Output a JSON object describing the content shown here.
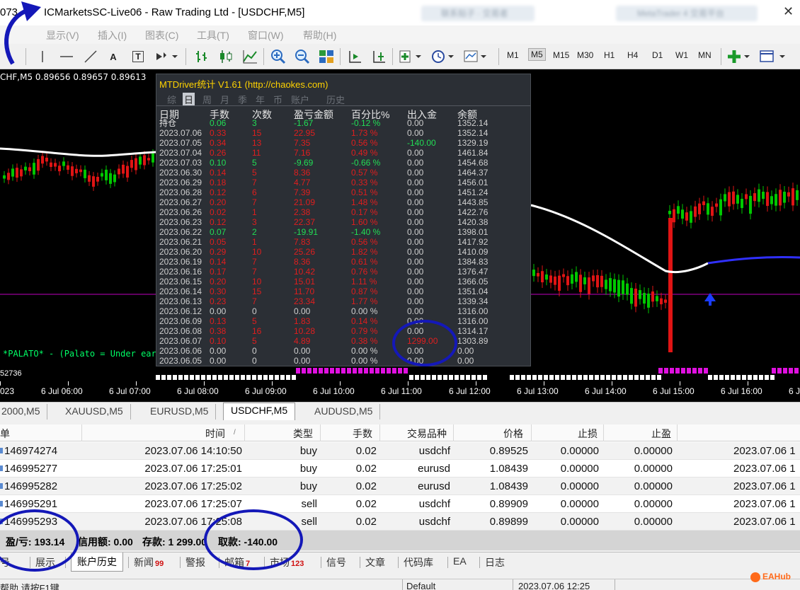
{
  "window": {
    "title": "ICMarketsSC-Live06 - Raw Trading Ltd - [USDCHF,M5]",
    "title_prefix": "073",
    "blurred_tab_1": "联系贴子 · 交易者",
    "blurred_tab_2": "MetaTrader 4 交易平台"
  },
  "menu": {
    "items": [
      "显示(V)",
      "插入(I)",
      "图表(C)",
      "工具(T)",
      "窗口(W)",
      "帮助(H)"
    ]
  },
  "toolbar": {
    "timeframes": [
      "M1",
      "M5",
      "M15",
      "M30",
      "H1",
      "H4",
      "D1",
      "W1",
      "MN"
    ],
    "active_timeframe": "M5",
    "text_tool": "A",
    "text_label_tool": "T"
  },
  "chart": {
    "ohlc": "CHF,M5  0.89656 0.89657 0.89613",
    "comment": "*PALATO* - (Palato = Under eart",
    "scale_value": "52736",
    "colors": {
      "bull": "#00c800",
      "bear": "#e01414",
      "ma": "#ffffff",
      "ma_tail": "#3030ff",
      "level": "#c000c0",
      "arrow": "#1a3cff"
    }
  },
  "stats": {
    "header": "MTDriver统计  V1.61  (http://chaokes.com)",
    "tabs": [
      "综",
      "日",
      "周",
      "月",
      "季",
      "年",
      "币",
      "账户",
      "历史"
    ],
    "selected_tab": "日",
    "columns": [
      "日期",
      "手数",
      "次数",
      "盈亏金额",
      "百分比%",
      "出入金",
      "余额"
    ],
    "rows": [
      {
        "date": "持仓",
        "lots": "0.06",
        "count": "3",
        "pnl": "-1.67",
        "pct": "-0.12 %",
        "io": "0.00",
        "bal": "1352.14",
        "c": "g"
      },
      {
        "date": "2023.07.06",
        "lots": "0.33",
        "count": "15",
        "pnl": "22.95",
        "pct": "1.73 %",
        "io": "0.00",
        "bal": "1352.14",
        "c": "r"
      },
      {
        "date": "2023.07.05",
        "lots": "0.34",
        "count": "13",
        "pnl": "7.35",
        "pct": "0.56 %",
        "io": "-140.00",
        "bal": "1329.19",
        "c": "r"
      },
      {
        "date": "2023.07.04",
        "lots": "0.26",
        "count": "11",
        "pnl": "7.16",
        "pct": "0.49 %",
        "io": "0.00",
        "bal": "1461.84",
        "c": "r"
      },
      {
        "date": "2023.07.03",
        "lots": "0.10",
        "count": "5",
        "pnl": "-9.69",
        "pct": "-0.66 %",
        "io": "0.00",
        "bal": "1454.68",
        "c": "g"
      },
      {
        "date": "2023.06.30",
        "lots": "0.14",
        "count": "5",
        "pnl": "8.36",
        "pct": "0.57 %",
        "io": "0.00",
        "bal": "1464.37",
        "c": "r"
      },
      {
        "date": "2023.06.29",
        "lots": "0.18",
        "count": "7",
        "pnl": "4.77",
        "pct": "0.33 %",
        "io": "0.00",
        "bal": "1456.01",
        "c": "r"
      },
      {
        "date": "2023.06.28",
        "lots": "0.12",
        "count": "6",
        "pnl": "7.39",
        "pct": "0.51 %",
        "io": "0.00",
        "bal": "1451.24",
        "c": "r"
      },
      {
        "date": "2023.06.27",
        "lots": "0.20",
        "count": "7",
        "pnl": "21.09",
        "pct": "1.48 %",
        "io": "0.00",
        "bal": "1443.85",
        "c": "r"
      },
      {
        "date": "2023.06.26",
        "lots": "0.02",
        "count": "1",
        "pnl": "2.38",
        "pct": "0.17 %",
        "io": "0.00",
        "bal": "1422.76",
        "c": "r"
      },
      {
        "date": "2023.06.23",
        "lots": "0.12",
        "count": "3",
        "pnl": "22.37",
        "pct": "1.60 %",
        "io": "0.00",
        "bal": "1420.38",
        "c": "r"
      },
      {
        "date": "2023.06.22",
        "lots": "0.07",
        "count": "2",
        "pnl": "-19.91",
        "pct": "-1.40 %",
        "io": "0.00",
        "bal": "1398.01",
        "c": "g"
      },
      {
        "date": "2023.06.21",
        "lots": "0.05",
        "count": "1",
        "pnl": "7.83",
        "pct": "0.56 %",
        "io": "0.00",
        "bal": "1417.92",
        "c": "r"
      },
      {
        "date": "2023.06.20",
        "lots": "0.29",
        "count": "10",
        "pnl": "25.26",
        "pct": "1.82 %",
        "io": "0.00",
        "bal": "1410.09",
        "c": "r"
      },
      {
        "date": "2023.06.19",
        "lots": "0.14",
        "count": "7",
        "pnl": "8.36",
        "pct": "0.61 %",
        "io": "0.00",
        "bal": "1384.83",
        "c": "r"
      },
      {
        "date": "2023.06.16",
        "lots": "0.17",
        "count": "7",
        "pnl": "10.42",
        "pct": "0.76 %",
        "io": "0.00",
        "bal": "1376.47",
        "c": "r"
      },
      {
        "date": "2023.06.15",
        "lots": "0.20",
        "count": "10",
        "pnl": "15.01",
        "pct": "1.11 %",
        "io": "0.00",
        "bal": "1366.05",
        "c": "r"
      },
      {
        "date": "2023.06.14",
        "lots": "0.30",
        "count": "15",
        "pnl": "11.70",
        "pct": "0.87 %",
        "io": "0.00",
        "bal": "1351.04",
        "c": "r"
      },
      {
        "date": "2023.06.13",
        "lots": "0.23",
        "count": "7",
        "pnl": "23.34",
        "pct": "1.77 %",
        "io": "0.00",
        "bal": "1339.34",
        "c": "r"
      },
      {
        "date": "2023.06.12",
        "lots": "0.00",
        "count": "0",
        "pnl": "0.00",
        "pct": "0.00 %",
        "io": "0.00",
        "bal": "1316.00",
        "c": "w"
      },
      {
        "date": "2023.06.09",
        "lots": "0.13",
        "count": "5",
        "pnl": "1.83",
        "pct": "0.14 %",
        "io": "0.00",
        "bal": "1316.00",
        "c": "r"
      },
      {
        "date": "2023.06.08",
        "lots": "0.38",
        "count": "16",
        "pnl": "10.28",
        "pct": "0.79 %",
        "io": "0.00",
        "bal": "1314.17",
        "c": "r"
      },
      {
        "date": "2023.06.07",
        "lots": "0.10",
        "count": "5",
        "pnl": "4.89",
        "pct": "0.38 %",
        "io": "1299.00",
        "bal": "1303.89",
        "c": "r"
      },
      {
        "date": "2023.06.06",
        "lots": "0.00",
        "count": "0",
        "pnl": "0.00",
        "pct": "0.00 %",
        "io": "0.00",
        "bal": "0.00",
        "c": "w"
      },
      {
        "date": "2023.06.05",
        "lots": "0.00",
        "count": "0",
        "pnl": "0.00",
        "pct": "0.00 %",
        "io": "0.00",
        "bal": "0.00",
        "c": "w"
      }
    ]
  },
  "timeaxis": {
    "labels": [
      "023",
      "6 Jul 06:00",
      "6 Jul 07:00",
      "6 Jul 08:00",
      "6 Jul 09:00",
      "6 Jul 10:00",
      "6 Jul 11:00",
      "6 Jul 12:00",
      "6 Jul 13:00",
      "6 Jul 14:00",
      "6 Jul 15:00",
      "6 Jul 16:00",
      "6 Jul 1"
    ]
  },
  "chart_tabs": {
    "items": [
      "2000,M5",
      "XAUUSD,M5",
      "EURUSD,M5",
      "USDCHF,M5",
      "AUDUSD,M5"
    ],
    "active": "USDCHF,M5"
  },
  "terminal": {
    "headers": [
      "单",
      "时间",
      "类型",
      "手数",
      "交易品种",
      "价格",
      "止损",
      "止盈"
    ],
    "sort_indicator": "/",
    "rows": [
      {
        "ticket": "146974274",
        "time": "2023.07.06 14:10:50",
        "type": "buy",
        "lots": "0.02",
        "symbol": "usdchf",
        "price": "0.89525",
        "sl": "0.00000",
        "tp": "0.00000",
        "close_time": "2023.07.06 1"
      },
      {
        "ticket": "146995277",
        "time": "2023.07.06 17:25:01",
        "type": "buy",
        "lots": "0.02",
        "symbol": "eurusd",
        "price": "1.08439",
        "sl": "0.00000",
        "tp": "0.00000",
        "close_time": "2023.07.06 1"
      },
      {
        "ticket": "146995282",
        "time": "2023.07.06 17:25:02",
        "type": "buy",
        "lots": "0.02",
        "symbol": "eurusd",
        "price": "1.08439",
        "sl": "0.00000",
        "tp": "0.00000",
        "close_time": "2023.07.06 1"
      },
      {
        "ticket": "146995291",
        "time": "2023.07.06 17:25:07",
        "type": "sell",
        "lots": "0.02",
        "symbol": "usdchf",
        "price": "0.89909",
        "sl": "0.00000",
        "tp": "0.00000",
        "close_time": "2023.07.06 1"
      },
      {
        "ticket": "146995293",
        "time": "2023.07.06 17:25:08",
        "type": "sell",
        "lots": "0.02",
        "symbol": "usdchf",
        "price": "0.89899",
        "sl": "0.00000",
        "tp": "0.00000",
        "close_time": "2023.07.06 1"
      }
    ],
    "summary": {
      "profit": "盈/亏: 193.14",
      "credit": "信用额: 0.00",
      "deposit": "存款: 1 299.00",
      "withdraw": "取款: -140.00"
    }
  },
  "bottom_tabs": {
    "items": [
      {
        "label": "号",
        "badge": ""
      },
      {
        "label": "展示",
        "badge": ""
      },
      {
        "label": "账户历史",
        "badge": ""
      },
      {
        "label": "新闻",
        "badge": "99"
      },
      {
        "label": "警报",
        "badge": ""
      },
      {
        "label": "邮箱",
        "badge": "7"
      },
      {
        "label": "市场",
        "badge": "123"
      },
      {
        "label": "信号",
        "badge": ""
      },
      {
        "label": "文章",
        "badge": ""
      },
      {
        "label": "代码库",
        "badge": ""
      },
      {
        "label": "EA",
        "badge": ""
      },
      {
        "label": "日志",
        "badge": ""
      }
    ],
    "active": "账户历史"
  },
  "statusbar": {
    "help": "帮助 请按F1键",
    "profile": "Default",
    "time": "2023.07.06 12:25"
  },
  "watermark": "EAHub"
}
